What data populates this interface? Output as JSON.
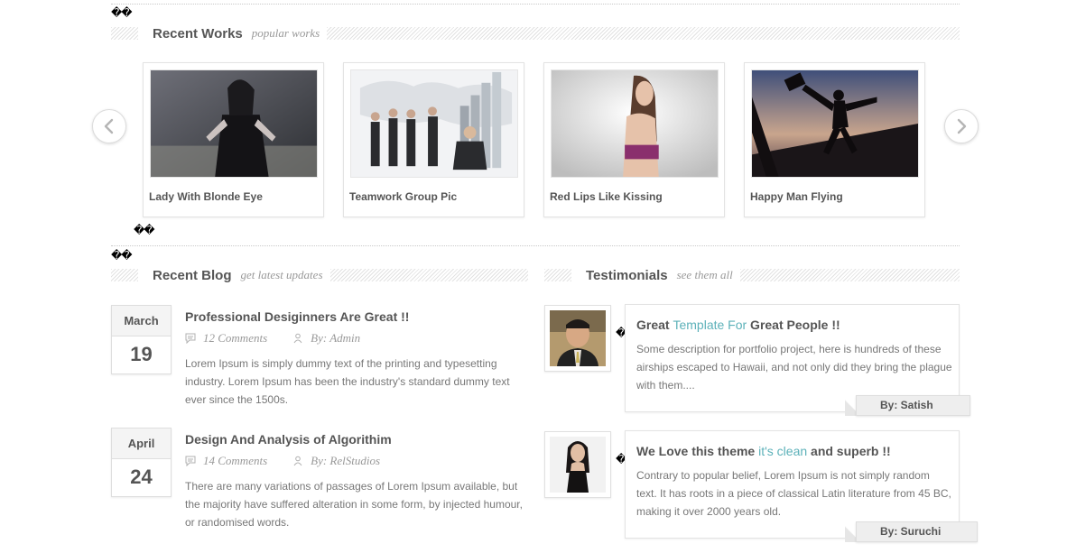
{
  "glyphs": {
    "mark": "��"
  },
  "recent_works": {
    "title": "Recent Works",
    "subtitle": "popular works",
    "items": [
      {
        "title": "Lady With Blonde Eye"
      },
      {
        "title": "Teamwork Group Pic"
      },
      {
        "title": "Red Lips Like Kissing"
      },
      {
        "title": "Happy Man Flying"
      }
    ]
  },
  "recent_blog": {
    "title": "Recent Blog",
    "subtitle": "get latest updates",
    "posts": [
      {
        "month": "March",
        "day": "19",
        "title": "Professional Desiginners Are Great !!",
        "comments": "12 Comments",
        "author": "By: Admin",
        "excerpt": "Lorem Ipsum is simply dummy text of the printing and typesetting industry. Lorem Ipsum has been the industry's standard dummy text ever since the 1500s."
      },
      {
        "month": "April",
        "day": "24",
        "title": "Design And Analysis of Algorithim",
        "comments": "14 Comments",
        "author": "By: RelStudios",
        "excerpt": "There are many variations of passages of Lorem Ipsum available, but the majority have suffered alteration in some form, by injected humour, or randomised words."
      }
    ]
  },
  "testimonials": {
    "title": "Testimonials",
    "subtitle": "see them all",
    "items": [
      {
        "title_before": "Great ",
        "title_highlight": "Template For",
        "title_after": " Great People !!",
        "text": "Some description for portfolio project, here is hundreds of these airships escaped to Hawaii, and not only did they bring the plague with them....",
        "author": "By: Satish"
      },
      {
        "title_before": "We Love this theme ",
        "title_highlight": "it's clean",
        "title_after": " and superb !!",
        "text": "Contrary to popular belief, Lorem Ipsum is not simply random text. It has roots in a piece of classical Latin literature from 45 BC, making it over 2000 years old.",
        "author": "By: Suruchi"
      }
    ]
  },
  "colors": {
    "accent": "#5cb1b9",
    "heading": "#555555",
    "muted": "#999999"
  }
}
